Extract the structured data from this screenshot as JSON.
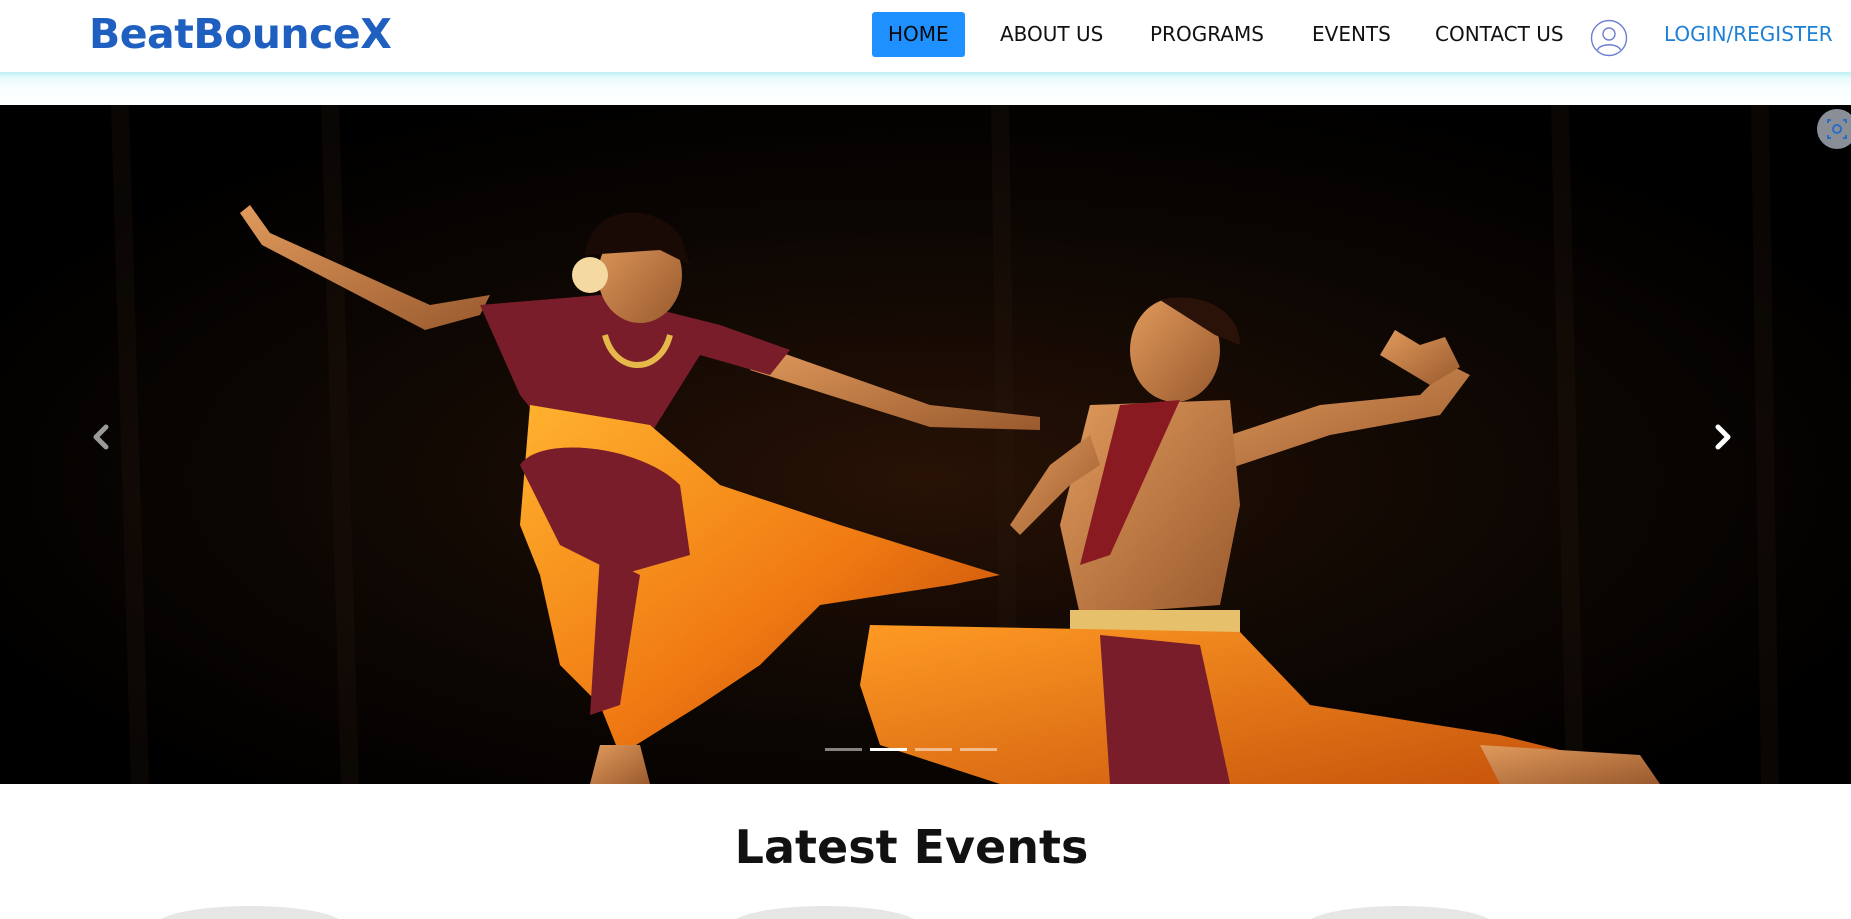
{
  "header": {
    "brand": "BeatBounceX",
    "nav": [
      {
        "label": "HOME",
        "active": true
      },
      {
        "label": "ABOUT US",
        "active": false
      },
      {
        "label": "PROGRAMS",
        "active": false
      },
      {
        "label": "EVENTS",
        "active": false
      },
      {
        "label": "CONTACT US",
        "active": false
      }
    ],
    "user_icon": "user-circle-icon",
    "login_label": "LOGIN/REGISTER"
  },
  "carousel": {
    "slide_count": 4,
    "active_slide": 2,
    "prev_icon": "chevron-left-icon",
    "next_icon": "chevron-right-icon"
  },
  "events": {
    "title": "Latest Events"
  },
  "colors": {
    "brand": "#1f5fc0",
    "active_nav_bg": "#1e90ff",
    "login_link": "#1e7fd6"
  }
}
